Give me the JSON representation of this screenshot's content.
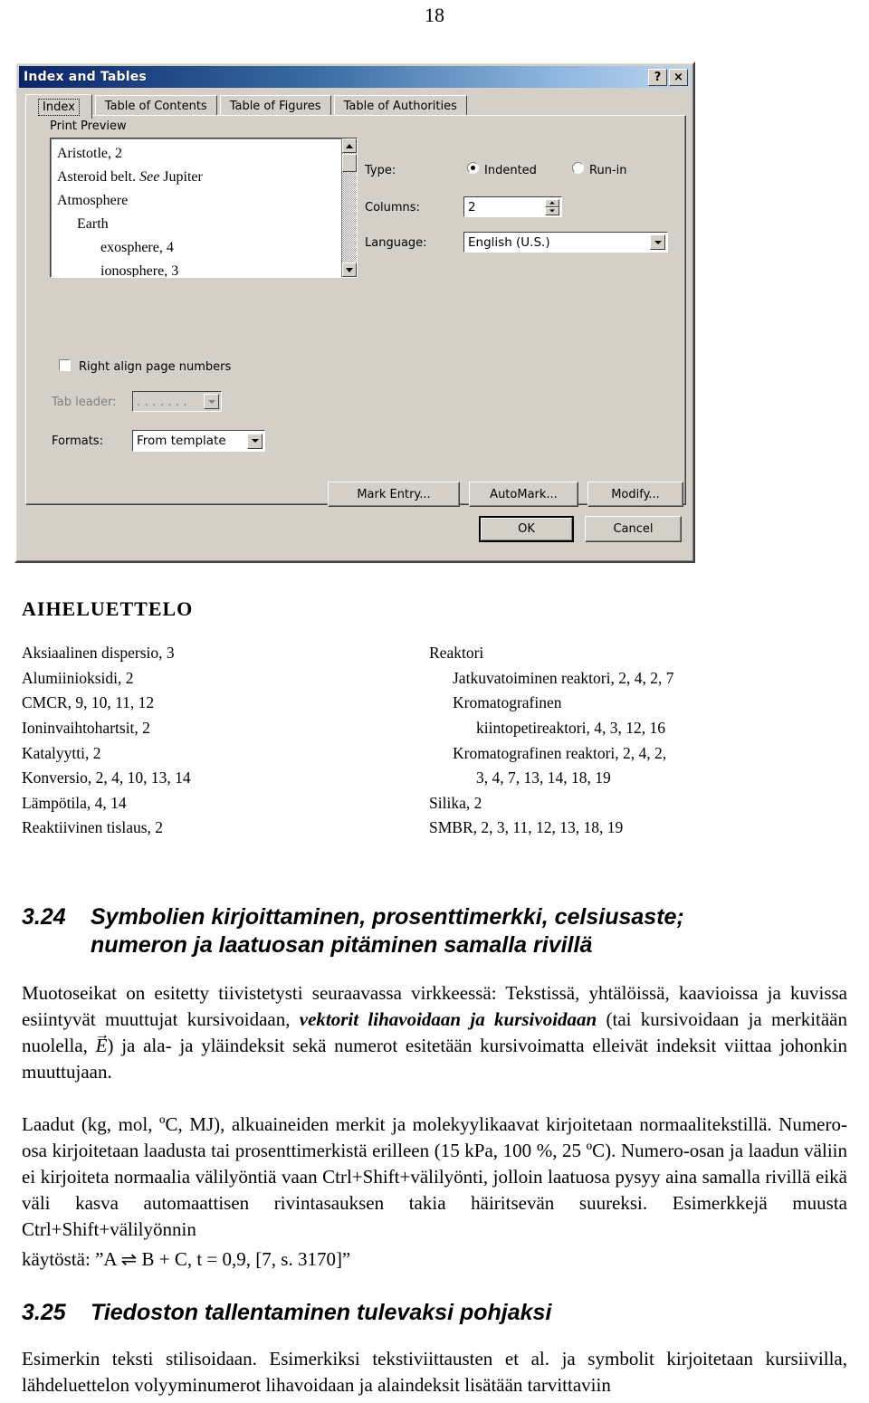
{
  "page": {
    "number": "18"
  },
  "dialog": {
    "title": "Index and Tables",
    "help_button": "?",
    "close_button": "×",
    "tabs": [
      {
        "label": "Index",
        "selected": true
      },
      {
        "label": "Table of Contents",
        "selected": false
      },
      {
        "label": "Table of Figures",
        "selected": false
      },
      {
        "label": "Table of Authorities",
        "selected": false
      }
    ],
    "print_preview": {
      "label": "Print Preview",
      "lines": [
        {
          "text": "Aristotle, 2",
          "indent": 0,
          "italic_part": ""
        },
        {
          "text": "Asteroid belt. ",
          "indent": 0,
          "italic_part": "See",
          "tail": " Jupiter"
        },
        {
          "text": "Atmosphere",
          "indent": 0
        },
        {
          "text": "Earth",
          "indent": 1
        },
        {
          "text": "exosphere, 4",
          "indent": 2
        },
        {
          "text": "ionosphere, 3",
          "indent": 2
        }
      ]
    },
    "type": {
      "label": "Type:",
      "options": [
        "Indented",
        "Run-in"
      ],
      "selected": "Indented"
    },
    "columns": {
      "label": "Columns:",
      "value": "2"
    },
    "language": {
      "label": "Language:",
      "value": "English (U.S.)"
    },
    "right_align": {
      "label": "Right align page numbers",
      "checked": false
    },
    "tab_leader": {
      "label": "Tab leader:",
      "value": ". . . . . . .",
      "disabled": true
    },
    "formats": {
      "label": "Formats:",
      "value": "From template"
    },
    "buttons": {
      "mark_entry": "Mark Entry...",
      "automark": "AutoMark...",
      "modify": "Modify...",
      "ok": "OK",
      "cancel": "Cancel"
    }
  },
  "index_sample": {
    "title": "AIHELUETTELO",
    "left_column": [
      {
        "text": "Aksiaalinen dispersio, 3",
        "indent": 0
      },
      {
        "text": "Alumiinioksidi, 2",
        "indent": 0
      },
      {
        "text": "CMCR, 9, 10, 11, 12",
        "indent": 0
      },
      {
        "text": "Ioninvaihtohartsit, 2",
        "indent": 0
      },
      {
        "text": "Katalyytti, 2",
        "indent": 0
      },
      {
        "text": "Konversio, 2, 4, 10, 13, 14",
        "indent": 0
      },
      {
        "text": "Lämpötila, 4, 14",
        "indent": 0
      },
      {
        "text": "Reaktiivinen tislaus, 2",
        "indent": 0
      }
    ],
    "right_column": [
      {
        "text": "Reaktori",
        "indent": 0
      },
      {
        "text": "Jatkuvatoiminen reaktori, 2, 4, 2, 7",
        "indent": 1
      },
      {
        "text": "Kromatografinen",
        "indent": 1
      },
      {
        "text": "kiintopetireaktori, 4, 3, 12, 16",
        "indent": 2
      },
      {
        "text": "Kromatografinen reaktori, 2, 4, 2,",
        "indent": 1
      },
      {
        "text": "3, 4, 7, 13, 14, 18, 19",
        "indent": 2
      },
      {
        "text": "Silika, 2",
        "indent": 0
      },
      {
        "text": "SMBR, 2, 3, 11, 12, 13, 18, 19",
        "indent": 0
      }
    ]
  },
  "sections": [
    {
      "number": "3.24",
      "title_line1": "Symbolien   kirjoittaminen,   prosenttimerkki,   celsiusaste;",
      "title_line2": "numeron ja laatuosan pitäminen samalla rivillä"
    },
    {
      "number": "3.25",
      "title_line1": "Tiedoston tallentaminen tulevaksi pohjaksi",
      "title_line2": ""
    }
  ],
  "paragraphs": {
    "p1_a": "Muotoseikat on esitetty tiivistetysti seuraavassa virkkeessä: Tekstissä, yhtälöissä, kaavioissa ja kuvissa esiintyvät muuttujat kursivoidaan, ",
    "p1_bold": "vektorit lihavoidaan ja kursivoidaan",
    "p1_b": " (tai kursivoidaan ja merkitään nuolella, ",
    "p1_symbol": "E",
    "p1_c": ") ja ala- ja yläindeksit sekä numerot esitetään kursivoimatta elleivät indeksit viittaa johonkin muuttujaan.",
    "p2": "Laadut (kg, mol, ºC, MJ), alkuaineiden merkit ja molekyylikaavat kirjoitetaan normaalitekstillä. Numero-osa kirjoitetaan laadusta tai prosenttimerkistä erilleen (15 kPa, 100 %, 25 ºC). Numero-osan ja laadun väliin ei kirjoiteta normaalia välilyöntiä vaan Ctrl+Shift+välilyönti, jolloin laatuosa pysyy aina samalla rivillä eikä väli kasva automaattisen rivintasauksen takia häiritsevän suureksi. Esimerkkejä muusta Ctrl+Shift+välilyönnin",
    "p2_last": "käytöstä: ”A ⇌ B + C, t = 0,9, [7, s. 3170]”",
    "p3": "Esimerkin teksti stilisoidaan. Esimerkiksi tekstiviittausten et al. ja symbolit kirjoitetaan kursiivilla, lähdeluettelon volyyminumerot lihavoidaan ja alaindeksit lisätään tarvittaviin"
  }
}
